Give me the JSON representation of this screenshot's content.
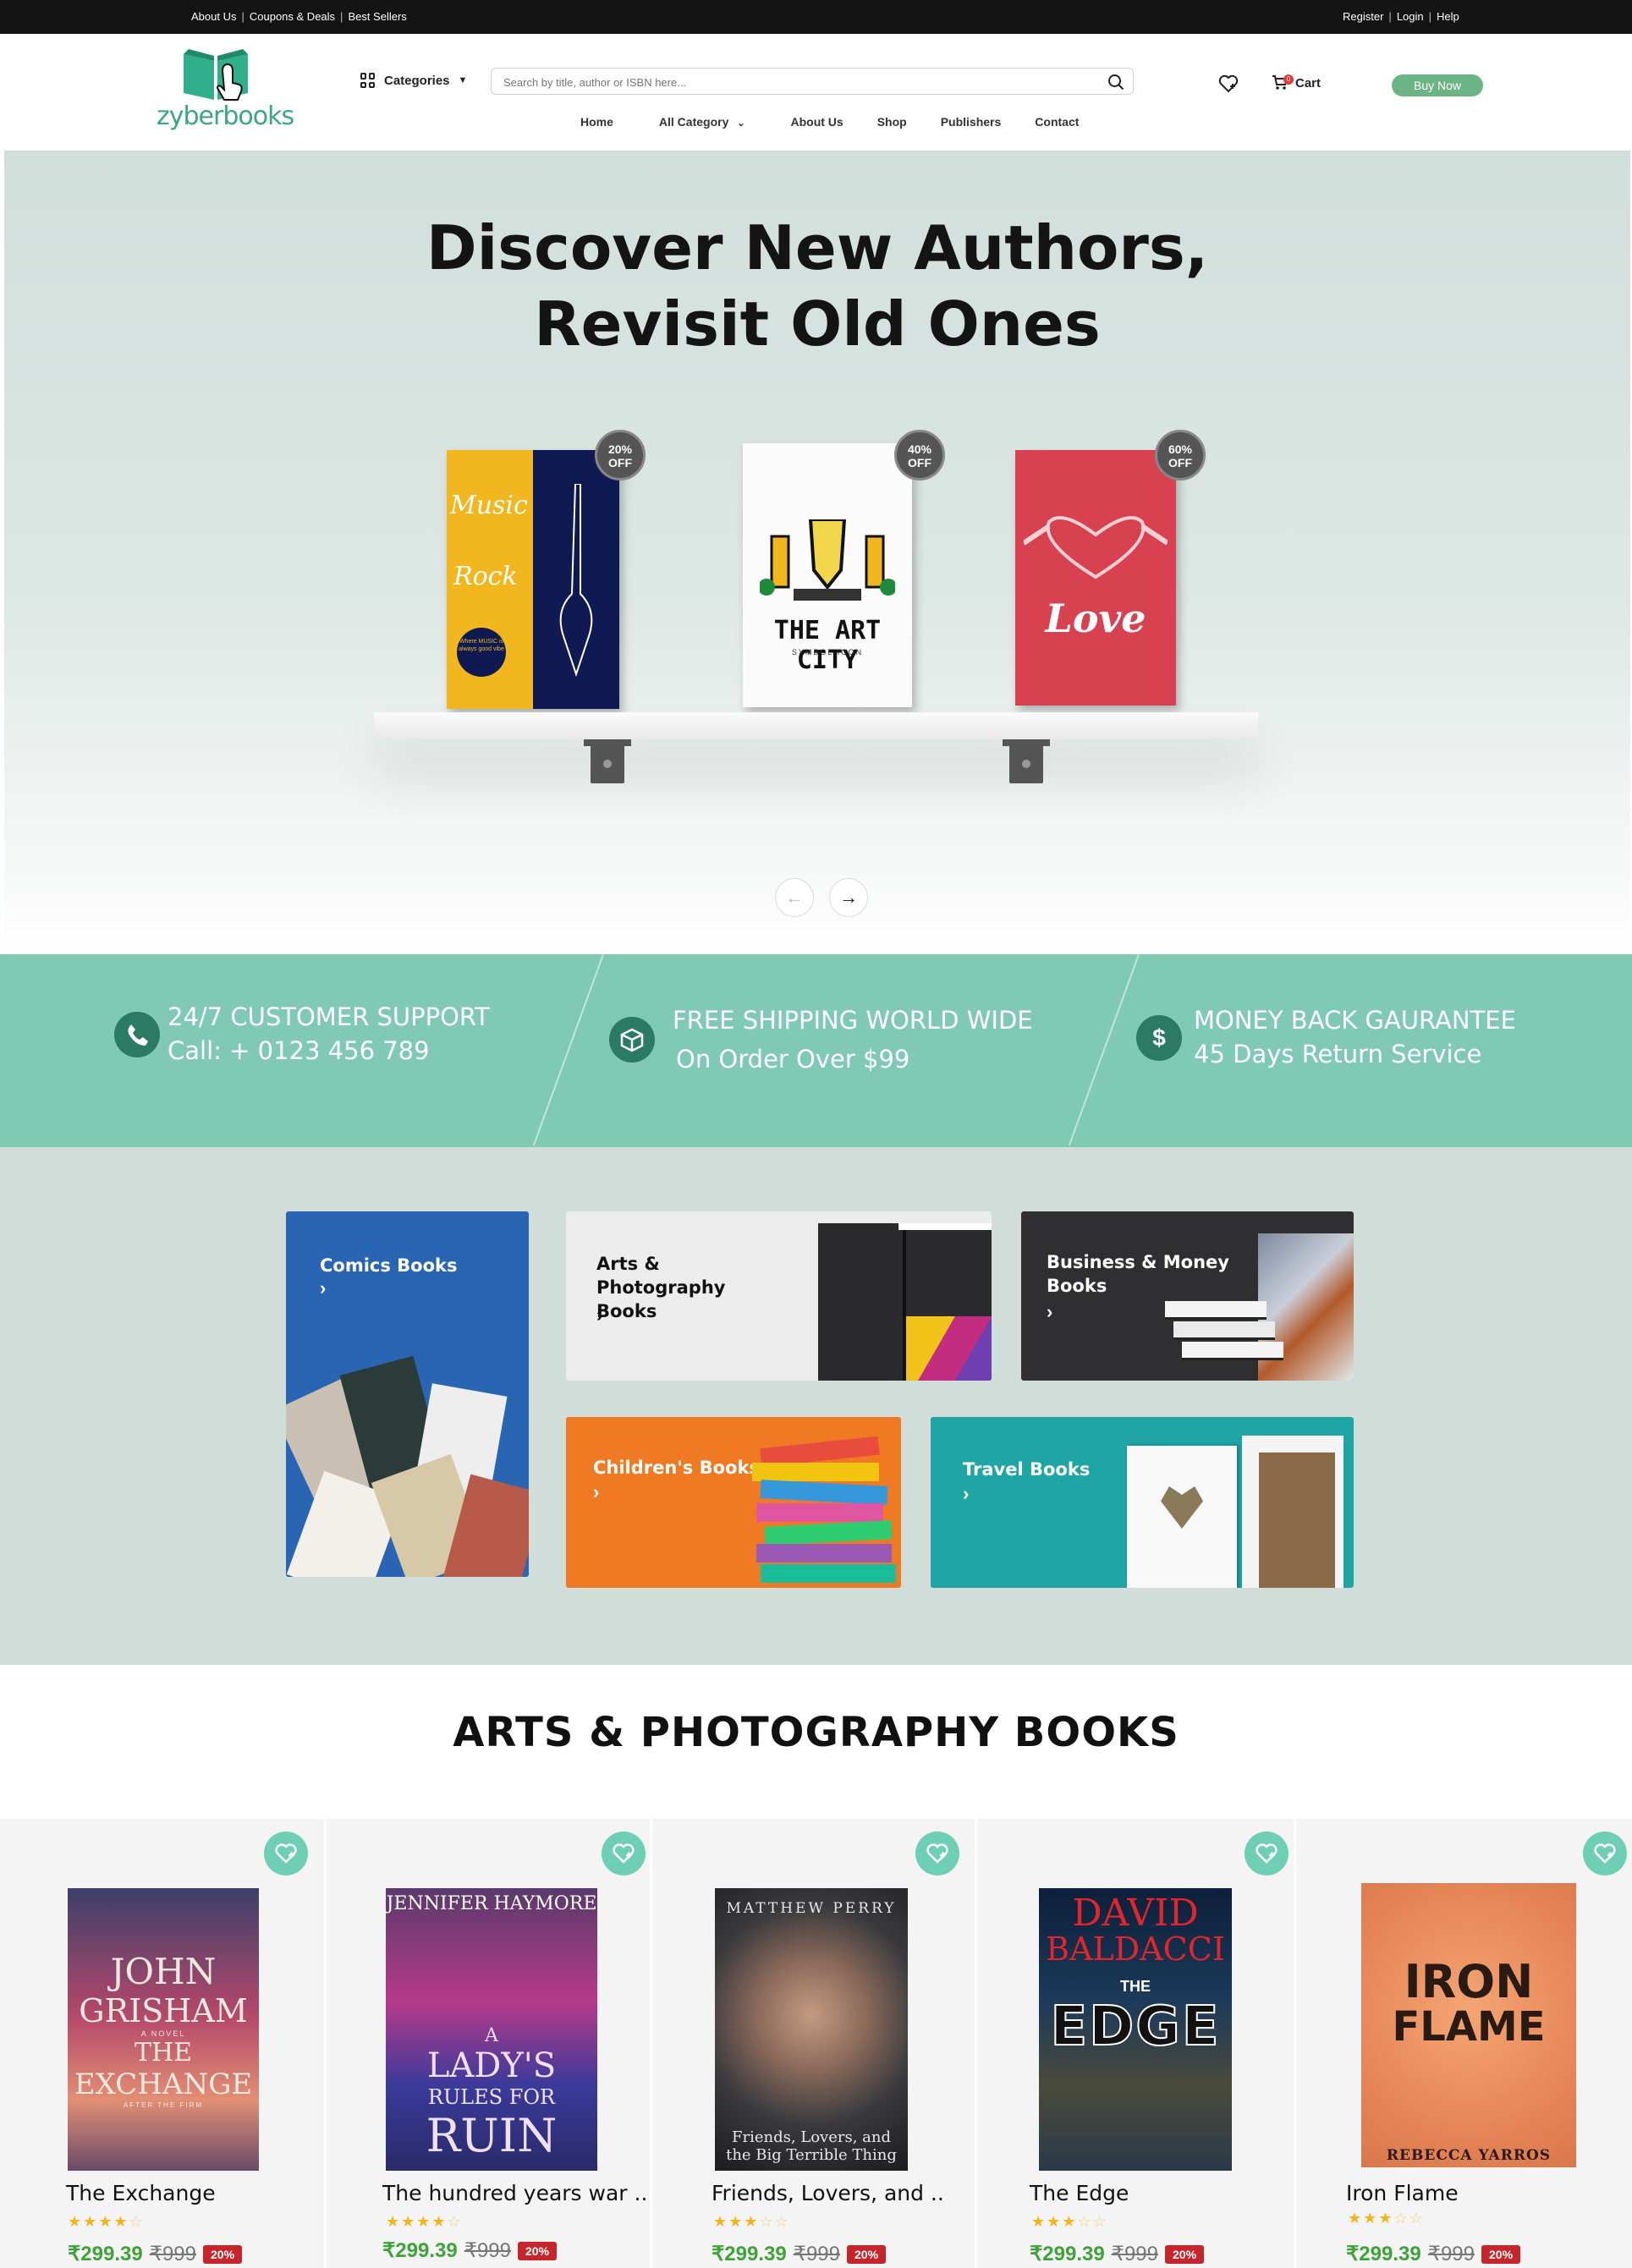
{
  "topbar": {
    "left": [
      "About Us",
      "Coupons & Deals",
      "Best Sellers"
    ],
    "right": [
      "Register",
      "Login",
      "Help"
    ],
    "separator": "|"
  },
  "header": {
    "logo_text": "zyberbooks",
    "categories_label": "Categories",
    "search_placeholder": "Search by title, author or ISBN here...",
    "cart_label": "Cart",
    "cart_count": "0",
    "buy_now": "Buy Now",
    "nav": [
      "Home",
      "All Category",
      "About Us",
      "Shop",
      "Publishers",
      "Contact"
    ]
  },
  "hero": {
    "title_line1": "Discover New Authors,",
    "title_line2": "Revisit Old Ones",
    "books": [
      {
        "offer_pct": "20%",
        "offer_word": "OFF",
        "cover_words": [
          "Music",
          "Rock",
          "Where MUSIC is always good vibe"
        ]
      },
      {
        "offer_pct": "40%",
        "offer_word": "OFF",
        "cover_words": [
          "THE ART CITY",
          "SYMBOL ICON"
        ]
      },
      {
        "offer_pct": "60%",
        "offer_word": "OFF",
        "cover_words": [
          "Love"
        ]
      }
    ]
  },
  "features": [
    {
      "line1": "24/7 CUSTOMER SUPPORT",
      "line2": "Call: + 0123 456 789",
      "icon": "phone-icon"
    },
    {
      "line1": "FREE SHIPPING WORLD WIDE",
      "line2": "On Order Over $99",
      "icon": "box-icon"
    },
    {
      "line1": "MONEY BACK GAURANTEE",
      "line2": "45 Days Return Service",
      "icon": "dollar-icon"
    }
  ],
  "categories": [
    {
      "label": "Comics Books",
      "chev": "›"
    },
    {
      "label": "Arts & Photography Books",
      "chev": "›"
    },
    {
      "label": "Business & Money Books",
      "chev": "›"
    },
    {
      "label": "Children's Books",
      "chev": "›"
    },
    {
      "label": "Travel Books",
      "chev": "›"
    }
  ],
  "section_title": "ARTS & PHOTOGRAPHY BOOKS",
  "products": [
    {
      "title": "The Exchange",
      "rating": 4,
      "price": "₹299.39",
      "mrp": "₹999",
      "discount": "20%",
      "cover": [
        "JOHN",
        "GRISHAM",
        "A NOVEL",
        "THE",
        "EXCHANGE",
        "AFTER THE FIRM"
      ]
    },
    {
      "title": "The hundred years war ..",
      "rating": 4,
      "price": "₹299.39",
      "mrp": "₹999",
      "discount": "20%",
      "cover": [
        "JENNIFER HAYMORE",
        "A",
        "LADY'S",
        "RULES FOR",
        "RUIN"
      ]
    },
    {
      "title": "Friends, Lovers, and ..",
      "rating": 3,
      "price": "₹299.39",
      "mrp": "₹999",
      "discount": "20%",
      "cover": [
        "MATTHEW PERRY",
        "Friends, Lovers, and",
        "the Big Terrible Thing"
      ]
    },
    {
      "title": "The Edge",
      "rating": 3,
      "price": "₹299.39",
      "mrp": "₹999",
      "discount": "20%",
      "cover": [
        "DAVID",
        "BALDACCI",
        "THE",
        "EDGE"
      ]
    },
    {
      "title": "Iron Flame",
      "rating": 3,
      "price": "₹299.39",
      "mrp": "₹999",
      "discount": "20%",
      "cover": [
        "IRON",
        "FLAME",
        "REBECCA YARROS"
      ]
    }
  ],
  "colors": {
    "accent": "#80cab4",
    "brand": "#3aa682",
    "dark": "#141414",
    "price": "#3fa33a",
    "sale": "#c6252c"
  }
}
